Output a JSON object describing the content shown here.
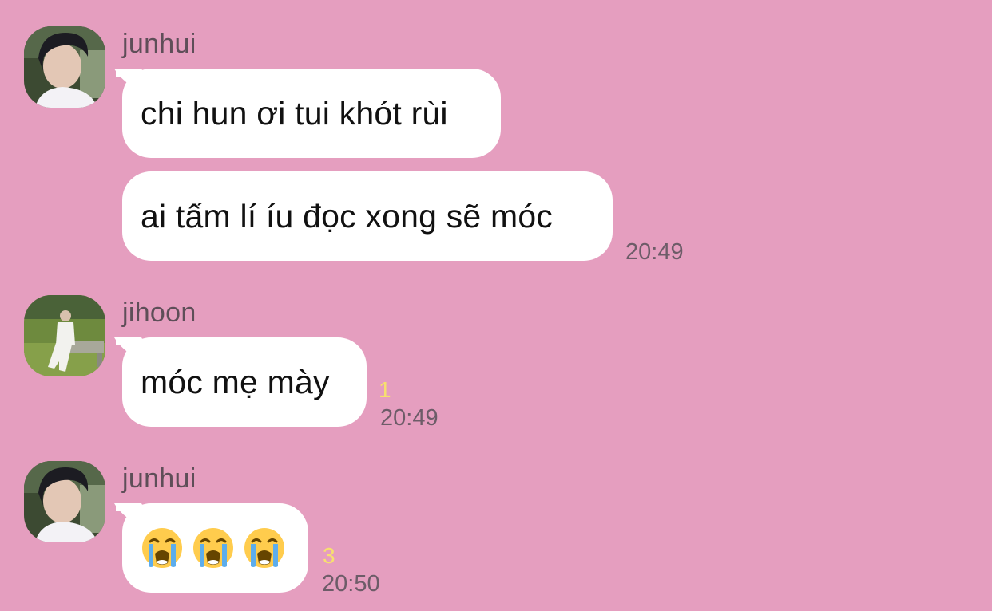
{
  "messages": [
    {
      "sender": "junhui",
      "bubbles": [
        "chi hun ơi tui khót rùi",
        "ai tấm lí íu đọc xong sẽ móc"
      ],
      "time": "20:49",
      "unread": ""
    },
    {
      "sender": "jihoon",
      "bubbles": [
        "móc mẹ mày"
      ],
      "time": "20:49",
      "unread": "1"
    },
    {
      "sender": "junhui",
      "emoji": [
        "loudly-crying-face",
        "loudly-crying-face",
        "loudly-crying-face"
      ],
      "time": "20:50",
      "unread": "3"
    }
  ],
  "colors": {
    "background": "#e59ebf",
    "bubble": "#ffffff",
    "sender": "#5e4e58",
    "time": "#6d5c68",
    "unread": "#f7e06e"
  }
}
